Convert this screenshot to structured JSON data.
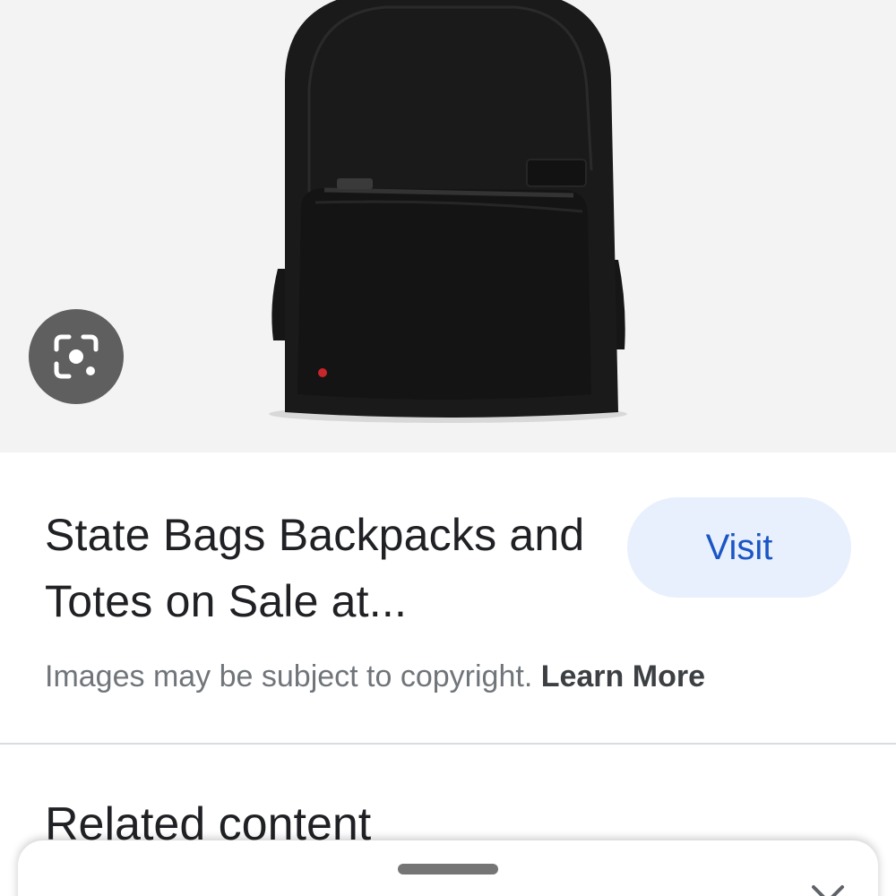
{
  "image": {
    "alt": "State Bags Backpacks and Totes on Sale at...",
    "icon": "backpack-image"
  },
  "lens": {
    "icon": "lens-search-icon"
  },
  "result": {
    "title": "State Bags Backpacks and Totes on Sale at...",
    "visit_label": "Visit"
  },
  "copyright": {
    "text": "Images may be subject to copyright.",
    "learn_more": "Learn More"
  },
  "related": {
    "heading": "Related content"
  },
  "sheet": {
    "close_icon": "close-icon"
  },
  "colors": {
    "accent": "#1a56c4",
    "visit_bg": "#e8f0fe",
    "image_bg": "#f3f3f3",
    "lens_bg": "#5f5f5f"
  }
}
